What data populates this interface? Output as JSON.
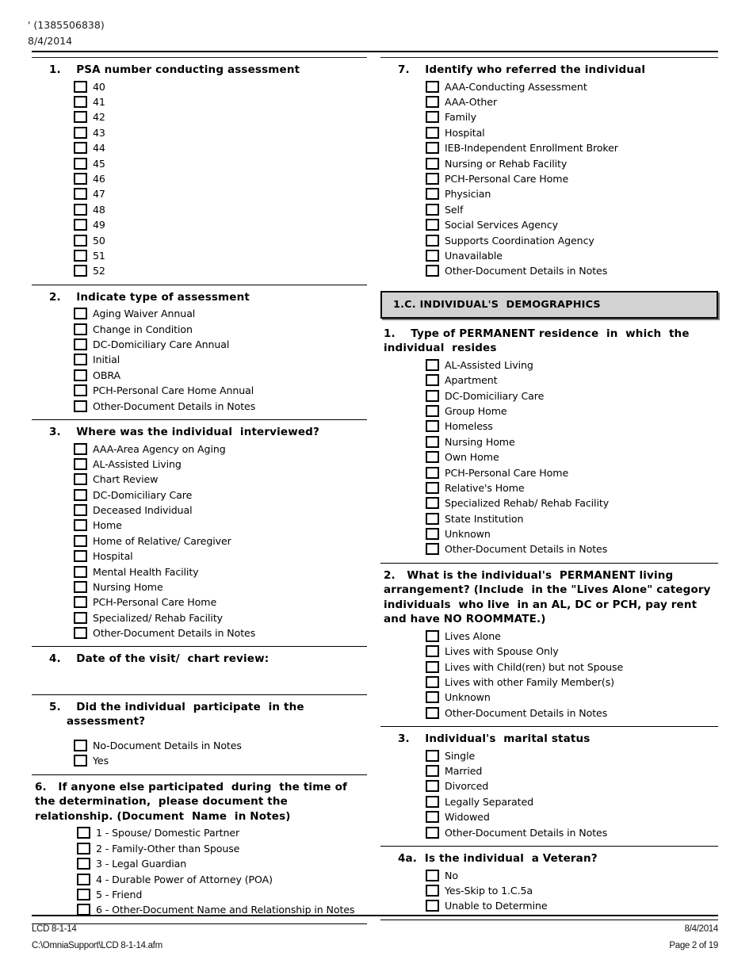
{
  "header": {
    "title_line": "' (1385506838)",
    "date_line": "8/4/2014"
  },
  "footer": {
    "form_id": "LCD 8-1-14",
    "date": "8/4/2014",
    "file_path": "C:\\OmniaSupport\\LCD 8-1-14.afm",
    "page_label": "Page 2 of 19"
  },
  "left_column": {
    "q1": {
      "number": "1.",
      "title": "PSA number conducting assessment",
      "options": [
        "40",
        "41",
        "42",
        "43",
        "44",
        "45",
        "46",
        "47",
        "48",
        "49",
        "50",
        "51",
        "52"
      ]
    },
    "q2": {
      "number": "2.",
      "title": "Indicate type of assessment",
      "options": [
        "Aging Waiver Annual",
        "Change in Condition",
        "DC-Domiciliary Care Annual",
        "Initial",
        "OBRA",
        "PCH-Personal Care Home Annual",
        "Other-Document Details in Notes"
      ]
    },
    "q3": {
      "number": "3.",
      "title": "Where was the individual  interviewed?",
      "options": [
        "AAA-Area Agency on Aging",
        "AL-Assisted Living",
        "Chart Review",
        "DC-Domiciliary Care",
        "Deceased Individual",
        "Home",
        "Home of Relative/ Caregiver",
        "Hospital",
        "Mental Health Facility",
        "Nursing Home",
        "PCH-Personal Care Home",
        "Specialized/ Rehab Facility",
        "Other-Document Details in Notes"
      ]
    },
    "q4": {
      "number": "4.",
      "title": "Date of the visit/  chart review:",
      "options": []
    },
    "q5": {
      "number": "5.",
      "title": "Did the individual  participate  in the assessment?",
      "options": [
        "No-Document Details in Notes",
        "Yes"
      ]
    },
    "q6": {
      "number": "6.",
      "title": "If anyone else participated  during  the time of the determination,  please document the relationship. (Document  Name  in Notes)",
      "options": [
        "1 - Spouse/ Domestic Partner",
        "2 - Family-Other than Spouse",
        "3 - Legal Guardian",
        "4 - Durable Power of Attorney (POA)",
        "5 - Friend",
        "6 - Other-Document Name and Relationship in Notes"
      ]
    }
  },
  "right_column": {
    "q7": {
      "number": "7.",
      "title": "Identify who referred the individual",
      "options": [
        "AAA-Conducting Assessment",
        "AAA-Other",
        "Family",
        "Hospital",
        "IEB-Independent Enrollment Broker",
        "Nursing or Rehab Facility",
        "PCH-Personal Care Home",
        "Physician",
        "Self",
        "Social Services Agency",
        "Supports Coordination Agency",
        "Unavailable",
        "Other-Document Details in Notes"
      ]
    },
    "section_banner": "1.C. INDIVIDUAL'S  DEMOGRAPHICS",
    "q1": {
      "number": "1.",
      "title": "Type of PERMANENT residence  in  which  the individual  resides",
      "options": [
        "AL-Assisted Living",
        "Apartment",
        "DC-Domiciliary Care",
        "Group Home",
        "Homeless",
        "Nursing Home",
        "Own Home",
        "PCH-Personal Care Home",
        "Relative's Home",
        "Specialized Rehab/ Rehab Facility",
        "State Institution",
        "Unknown",
        "Other-Document Details in Notes"
      ]
    },
    "q2": {
      "number": "2.",
      "title": "What is the individual's  PERMANENT living arrangement? (Include  in the \"Lives Alone\" category individuals  who live  in an AL, DC or PCH, pay rent and have NO ROOMMATE.)",
      "options": [
        "Lives Alone",
        "Lives with Spouse Only",
        "Lives with Child(ren) but not Spouse",
        "Lives with other Family Member(s)",
        "Unknown",
        "Other-Document Details in Notes"
      ]
    },
    "q3": {
      "number": "3.",
      "title": "Individual's  marital status",
      "options": [
        "Single",
        "Married",
        "Divorced",
        "Legally Separated",
        "Widowed",
        "Other-Document Details in Notes"
      ]
    },
    "q4a": {
      "number": "4a.",
      "title": "Is the individual  a Veteran?",
      "options": [
        "No",
        "Yes-Skip to 1.C.5a",
        "Unable to Determine"
      ]
    }
  }
}
